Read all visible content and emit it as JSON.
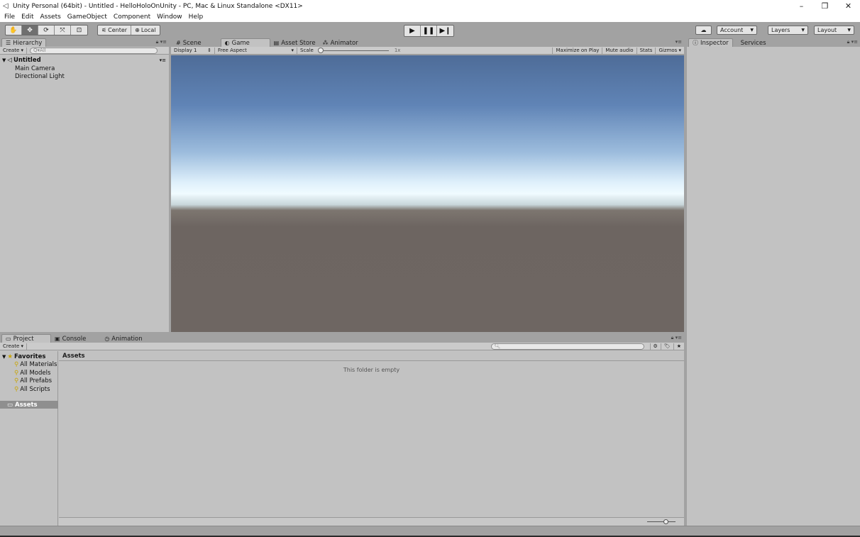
{
  "window": {
    "title": "Unity Personal (64bit) - Untitled - HelloHoloOnUnity - PC, Mac & Linux Standalone <DX11>",
    "controls": [
      "–",
      "❐",
      "✕"
    ]
  },
  "menu": [
    "File",
    "Edit",
    "Assets",
    "GameObject",
    "Component",
    "Window",
    "Help"
  ],
  "toolbar": {
    "tools": [
      "hand-icon",
      "move-icon",
      "rotate-icon",
      "scale-icon",
      "rect-icon"
    ],
    "pivot": "Center",
    "space": "Local",
    "account": "Account",
    "layers": "Layers",
    "layout": "Layout"
  },
  "hierarchy": {
    "tab": "Hierarchy",
    "create": "Create",
    "search_placeholder": "Q▾All",
    "scene": "Untitled",
    "items": [
      "Main Camera",
      "Directional Light"
    ]
  },
  "center_tabs": {
    "scene": "Scene",
    "game": "Game",
    "asset_store": "Asset Store",
    "animator": "Animator"
  },
  "game_bar": {
    "display": "Display 1",
    "aspect": "Free Aspect",
    "scale_label": "Scale",
    "scale_value": "1x",
    "maximize": "Maximize on Play",
    "mute": "Mute audio",
    "stats": "Stats",
    "gizmos": "Gizmos"
  },
  "inspector": {
    "tab": "Inspector",
    "services": "Services"
  },
  "project": {
    "tabs": [
      "Project",
      "Console",
      "Animation"
    ],
    "create": "Create",
    "favorites_label": "Favorites",
    "favorites": [
      "All Materials",
      "All Models",
      "All Prefabs",
      "All Scripts"
    ],
    "assets_root": "Assets",
    "breadcrumb": "Assets",
    "empty_message": "This folder is empty"
  },
  "colors": {
    "panel_bg": "#c2c2c2",
    "chrome_bg": "#a2a2a2",
    "selection": "#8f8f8f"
  }
}
